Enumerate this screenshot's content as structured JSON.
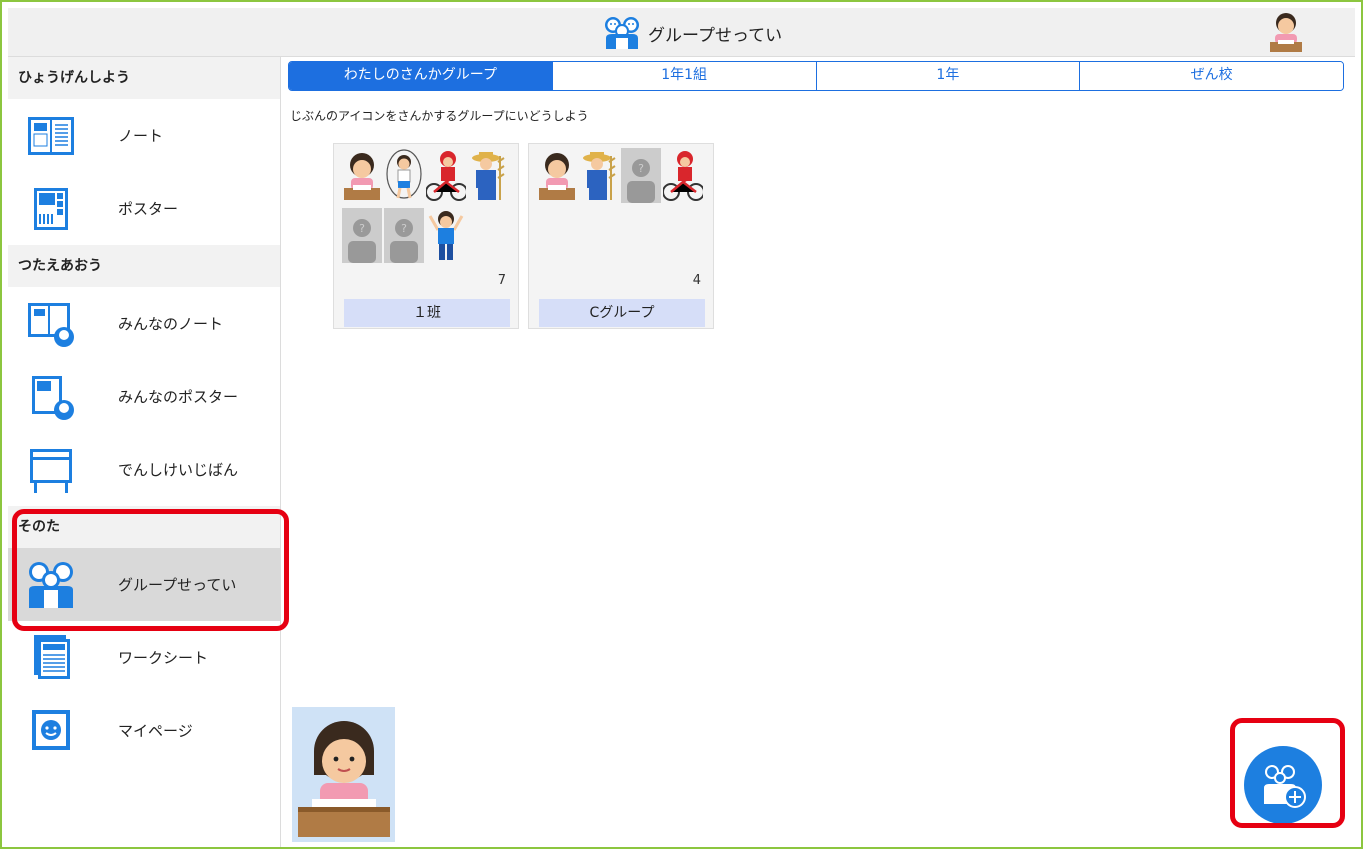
{
  "header": {
    "title": "グループせってい",
    "title_icon": "group-icon",
    "user_icon": "student-avatar-icon"
  },
  "sidebar": {
    "sections": [
      {
        "title": "ひょうげんしよう",
        "items": [
          {
            "label": "ノート",
            "icon": "note-icon"
          },
          {
            "label": "ポスター",
            "icon": "poster-icon"
          }
        ]
      },
      {
        "title": "つたえあおう",
        "items": [
          {
            "label": "みんなのノート",
            "icon": "shared-note-icon"
          },
          {
            "label": "みんなのポスター",
            "icon": "shared-poster-icon"
          },
          {
            "label": "でんしけいじばん",
            "icon": "bulletin-board-icon"
          }
        ]
      },
      {
        "title": "そのた",
        "items": [
          {
            "label": "グループせってい",
            "icon": "group-icon",
            "selected": true
          },
          {
            "label": "ワークシート",
            "icon": "worksheet-icon"
          },
          {
            "label": "マイページ",
            "icon": "mypage-icon"
          }
        ]
      }
    ]
  },
  "tabs": [
    {
      "label": "わたしのさんかグループ",
      "active": true
    },
    {
      "label": "1年1組",
      "active": false
    },
    {
      "label": "1年",
      "active": false
    },
    {
      "label": "ぜん校",
      "active": false
    }
  ],
  "instruction": "じぶんのアイコンをさんかするグループにいどうしよう",
  "groups": [
    {
      "name": "１班",
      "count": "7"
    },
    {
      "name": "Cグループ",
      "count": "4"
    }
  ],
  "colors": {
    "accent": "#1d6fe0",
    "highlight": "#e60012",
    "frame": "#8cc63f",
    "group_label_bg": "#d6def8"
  },
  "fab": {
    "icon": "add-group-icon"
  }
}
